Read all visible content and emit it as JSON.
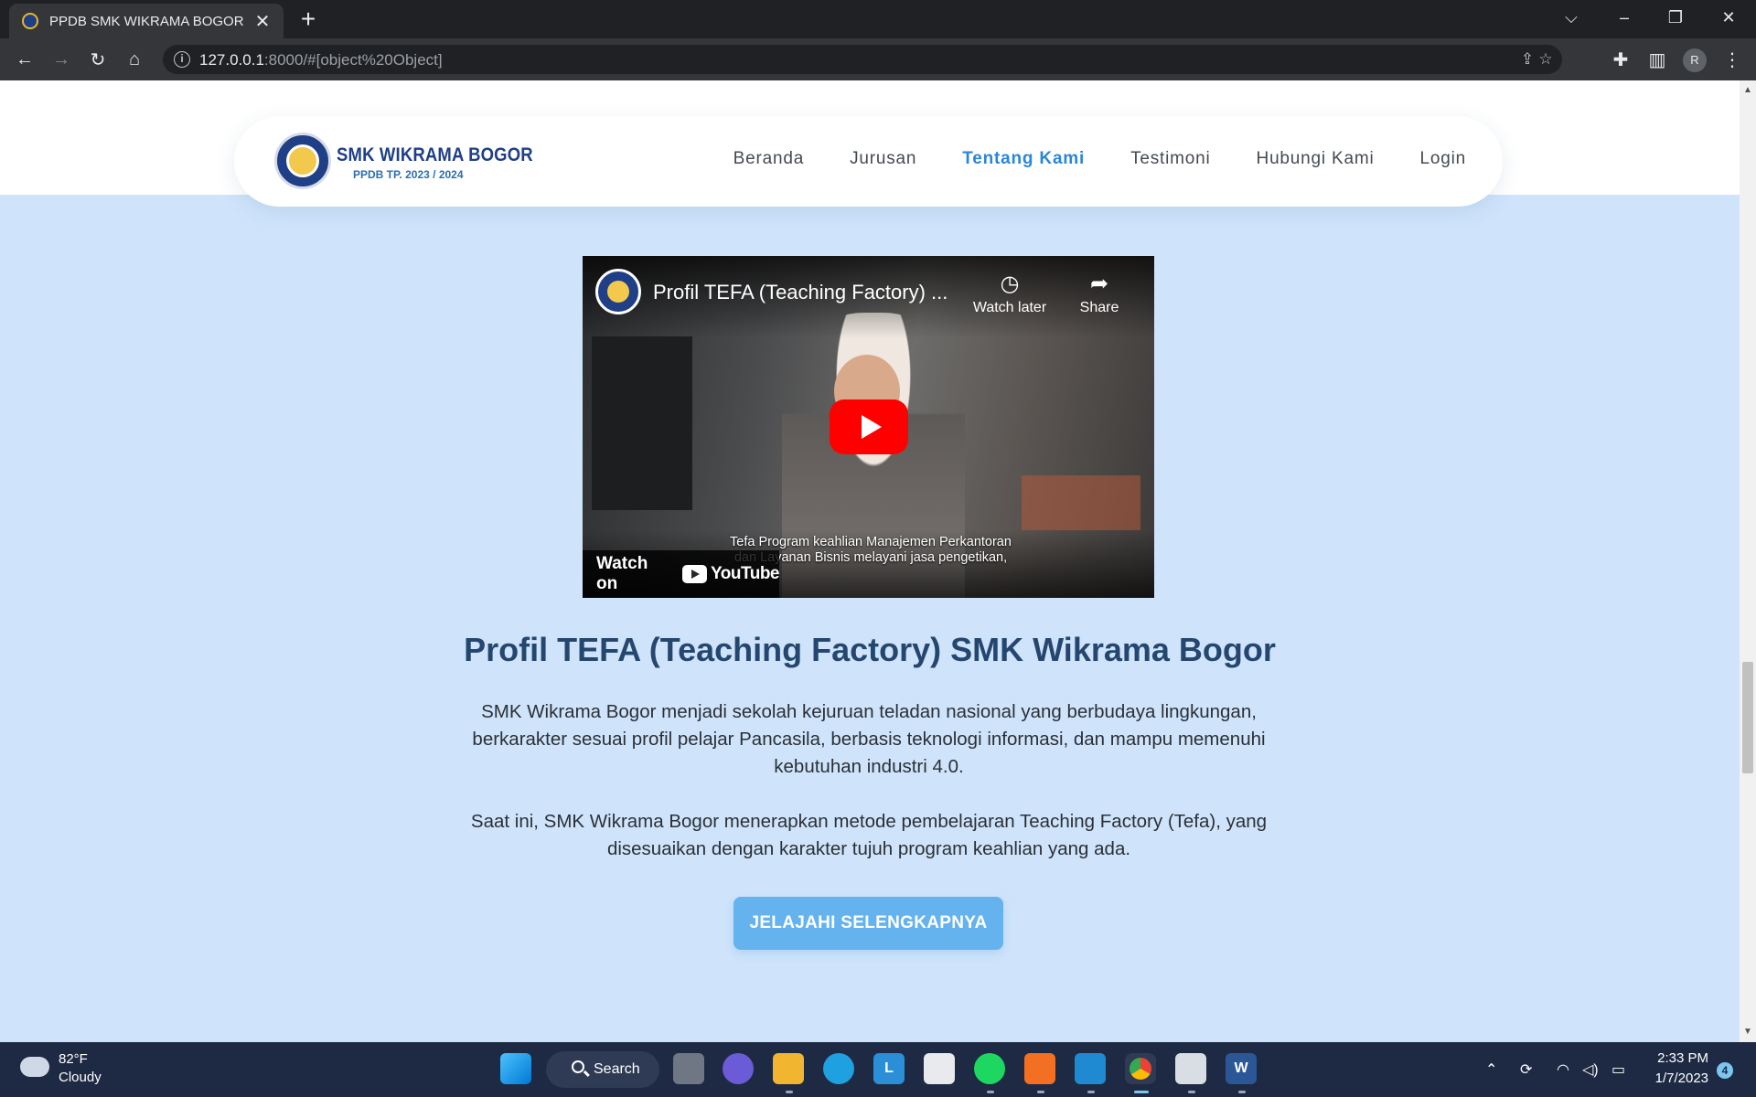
{
  "browser": {
    "tab_title": "PPDB SMK WIKRAMA BOGOR",
    "tab_close": "✕",
    "new_tab": "+",
    "url_host": "127.0.0.1",
    "url_rest": ":8000/#[object%20Object]",
    "profile_initial": "R"
  },
  "navbar": {
    "logo_title": "SMK WIKRAMA BOGOR",
    "logo_subtitle": "PPDB TP. 2023 / 2024",
    "links": [
      {
        "label": "Beranda",
        "active": false
      },
      {
        "label": "Jurusan",
        "active": false
      },
      {
        "label": "Tentang Kami",
        "active": true
      },
      {
        "label": "Testimoni",
        "active": false
      },
      {
        "label": "Hubungi Kami",
        "active": false
      },
      {
        "label": "Login",
        "active": false
      }
    ]
  },
  "video": {
    "title": "Profil TEFA (Teaching Factory) ...",
    "watch_later": "Watch later",
    "share": "Share",
    "caption_line1": "Tefa Program keahlian Manajemen Perkantoran",
    "caption_line2": "dan Layanan Bisnis melayani jasa pengetikan,",
    "watch_on": "Watch on",
    "youtube": "YouTube"
  },
  "content": {
    "heading": "Profil TEFA (Teaching Factory) SMK Wikrama Bogor",
    "paragraph1": "SMK Wikrama Bogor menjadi sekolah kejuruan teladan nasional yang berbudaya lingkungan, berkarakter sesuai profil pelajar Pancasila, berbasis teknologi informasi, dan mampu memenuhi kebutuhan industri 4.0.",
    "paragraph2": "Saat ini, SMK Wikrama Bogor menerapkan metode pembelajaran Teaching Factory (Tefa), yang disesuaikan dengan karakter tujuh program keahlian yang ada.",
    "cta_label": "JELAJAHI SELENGKAPNYA"
  },
  "taskbar": {
    "temperature": "82°F",
    "condition": "Cloudy",
    "search_label": "Search",
    "time": "2:33 PM",
    "date": "1/7/2023",
    "notification_count": "4"
  },
  "colors": {
    "page_background": "#cfe4fb",
    "heading": "#25476f",
    "accent": "#2a86d8",
    "cta": "#64b2ee"
  }
}
